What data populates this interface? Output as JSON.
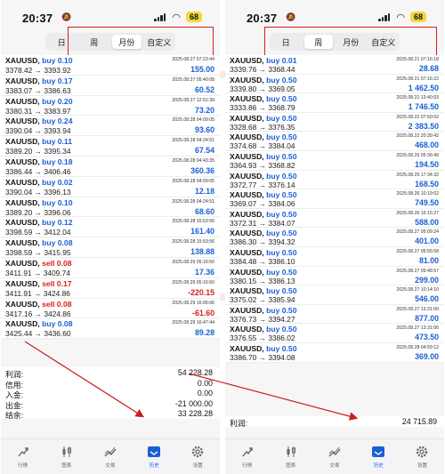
{
  "left": {
    "status": {
      "time": "20:37",
      "battery": "68"
    },
    "periods": [
      {
        "label": "日",
        "active": false
      },
      {
        "label": "周",
        "active": false
      },
      {
        "label": "月份",
        "active": true
      },
      {
        "label": "自定义",
        "active": false
      }
    ],
    "trades": [
      {
        "symbol": "XAUUSD,",
        "side": "buy 0.10",
        "side_type": "buy",
        "time": "2025.08.27 07:23:44",
        "open": "3378.42",
        "close": "3393.92",
        "profit": "155.00",
        "neg": false
      },
      {
        "symbol": "XAUUSD,",
        "side": "buy 0.17",
        "side_type": "buy",
        "time": "2025.08.27 05:40:08",
        "open": "3383.07",
        "close": "3386.63",
        "profit": "60.52",
        "neg": false
      },
      {
        "symbol": "XAUUSD,",
        "side": "buy 0.20",
        "time": "2025.08.27 12:51:39",
        "side_type": "buy",
        "open": "3380.31",
        "close": "3383.97",
        "profit": "73.20",
        "neg": false
      },
      {
        "symbol": "XAUUSD,",
        "side": "buy 0.24",
        "side_type": "buy",
        "time": "2025.08.28 04:09:05",
        "open": "3390.04",
        "close": "3393.94",
        "profit": "93.60",
        "neg": false
      },
      {
        "symbol": "XAUUSD,",
        "side": "buy 0.11",
        "side_type": "buy",
        "time": "2025.08.28 04:24:51",
        "open": "3389.20",
        "close": "3395.34",
        "profit": "67.54",
        "neg": false
      },
      {
        "symbol": "XAUUSD,",
        "side": "buy 0.18",
        "side_type": "buy",
        "time": "2025.08.28 04:43:35",
        "open": "3386.44",
        "close": "3406.46",
        "profit": "360.36",
        "neg": false
      },
      {
        "symbol": "XAUUSD,",
        "side": "buy 0.02",
        "side_type": "buy",
        "time": "2025.08.28 04:09:05",
        "open": "3390.04",
        "close": "3396.13",
        "profit": "12.18",
        "neg": false
      },
      {
        "symbol": "XAUUSD,",
        "side": "buy 0.10",
        "side_type": "buy",
        "time": "2025.08.28 04:24:51",
        "open": "3389.20",
        "close": "3396.06",
        "profit": "68.60",
        "neg": false
      },
      {
        "symbol": "XAUUSD,",
        "side": "buy 0.12",
        "side_type": "buy",
        "time": "2025.08.28 15:53:56",
        "open": "3398.59",
        "close": "3412.04",
        "profit": "161.40",
        "neg": false
      },
      {
        "symbol": "XAUUSD,",
        "side": "buy 0.08",
        "side_type": "buy",
        "time": "2025.08.28 15:53:56",
        "open": "3398.59",
        "close": "3415.95",
        "profit": "138.88",
        "neg": false
      },
      {
        "symbol": "XAUUSD,",
        "side": "sell 0.08",
        "side_type": "sell",
        "time": "2025.08.29 05:16:50",
        "open": "3411.91",
        "close": "3409.74",
        "profit": "17.36",
        "neg": false
      },
      {
        "symbol": "XAUUSD,",
        "side": "sell 0.17",
        "side_type": "sell",
        "time": "2025.08.29 05:16:50",
        "open": "3411.91",
        "close": "3424.86",
        "profit": "-220.15",
        "neg": true
      },
      {
        "symbol": "XAUUSD,",
        "side": "sell 0.08",
        "side_type": "sell",
        "time": "2025.08.29 16:05:06",
        "open": "3417.16",
        "close": "3424.86",
        "profit": "-61.60",
        "neg": true
      },
      {
        "symbol": "XAUUSD,",
        "side": "buy 0.08",
        "side_type": "buy",
        "time": "2025.08.29 16:47:44",
        "open": "3425.44",
        "close": "3436.60",
        "profit": "89.28",
        "neg": false
      }
    ],
    "summary": [
      {
        "label": "利润:",
        "value": "54 228.28"
      },
      {
        "label": "信用:",
        "value": "0.00"
      },
      {
        "label": "入金:",
        "value": "0.00"
      },
      {
        "label": "出金:",
        "value": "-21 000.00"
      },
      {
        "label": "结余:",
        "value": "33 228.28"
      }
    ]
  },
  "right": {
    "status": {
      "time": "20:37",
      "battery": "68"
    },
    "periods": [
      {
        "label": "日",
        "active": false
      },
      {
        "label": "周",
        "active": true
      },
      {
        "label": "月份",
        "active": false
      },
      {
        "label": "自定义",
        "active": false
      }
    ],
    "trades": [
      {
        "symbol": "XAUUSD,",
        "side": "buy 0.01",
        "side_type": "buy",
        "time": "2025.08.21 07:16:18",
        "open": "3339.76",
        "close": "3368.44",
        "profit": "28.68",
        "neg": false
      },
      {
        "symbol": "XAUUSD,",
        "side": "buy 0.50",
        "side_type": "buy",
        "time": "2025.08.21 07:16:22",
        "open": "3339.80",
        "close": "3369.05",
        "profit": "1 462.50",
        "neg": false
      },
      {
        "symbol": "XAUUSD,",
        "side": "buy 0.50",
        "side_type": "buy",
        "time": "2025.08.21 13:40:03",
        "open": "3333.86",
        "close": "3368.79",
        "profit": "1 746.50",
        "neg": false
      },
      {
        "symbol": "XAUUSD,",
        "side": "buy 0.50",
        "side_type": "buy",
        "time": "2025.08.22 07:50:02",
        "open": "3328.68",
        "close": "3376.35",
        "profit": "2 383.50",
        "neg": false
      },
      {
        "symbol": "XAUUSD,",
        "side": "buy 0.50",
        "side_type": "buy",
        "time": "2025.08.22 20:39:42",
        "open": "3374.68",
        "close": "3384.04",
        "profit": "468.00",
        "neg": false
      },
      {
        "symbol": "XAUUSD,",
        "side": "buy 0.50",
        "side_type": "buy",
        "time": "2025.08.25 05:36:49",
        "open": "3364.93",
        "close": "3368.82",
        "profit": "194.50",
        "neg": false
      },
      {
        "symbol": "XAUUSD,",
        "side": "buy 0.50",
        "side_type": "buy",
        "time": "2025.08.25 17:34:32",
        "open": "3372.77",
        "close": "3376.14",
        "profit": "168.50",
        "neg": false
      },
      {
        "symbol": "XAUUSD,",
        "side": "buy 0.50",
        "side_type": "buy",
        "time": "2025.08.26 10:19:02",
        "open": "3369.07",
        "close": "3384.06",
        "profit": "749.50",
        "neg": false
      },
      {
        "symbol": "XAUUSD,",
        "side": "buy 0.50",
        "side_type": "buy",
        "time": "2025.08.26 16:15:27",
        "open": "3372.31",
        "close": "3384.07",
        "profit": "588.00",
        "neg": false
      },
      {
        "symbol": "XAUUSD,",
        "side": "buy 0.50",
        "side_type": "buy",
        "time": "2025.08.27 05:09:24",
        "open": "3386.30",
        "close": "3394.32",
        "profit": "401.00",
        "neg": false
      },
      {
        "symbol": "XAUUSD,",
        "side": "buy 0.50",
        "side_type": "buy",
        "time": "2025.08.27 05:55:58",
        "open": "3384.48",
        "close": "3386.10",
        "profit": "81.00",
        "neg": false
      },
      {
        "symbol": "XAUUSD,",
        "side": "buy 0.50",
        "side_type": "buy",
        "time": "2025.08.27 09:48:57",
        "open": "3380.15",
        "close": "3386.13",
        "profit": "299.00",
        "neg": false
      },
      {
        "symbol": "XAUUSD,",
        "side": "buy 0.50",
        "side_type": "buy",
        "time": "2025.08.27 10:14:10",
        "open": "3375.02",
        "close": "3385.94",
        "profit": "546.00",
        "neg": false
      },
      {
        "symbol": "XAUUSD,",
        "side": "buy 0.50",
        "side_type": "buy",
        "time": "2025.08.27 13:31:00",
        "open": "3376.73",
        "close": "3394.27",
        "profit": "877.00",
        "neg": false
      },
      {
        "symbol": "XAUUSD,",
        "side": "buy 0.50",
        "side_type": "buy",
        "time": "2025.08.27 13:31:06",
        "open": "3376.55",
        "close": "3386.02",
        "profit": "473.50",
        "neg": false
      },
      {
        "symbol": "XAUUSD,",
        "side": "buy 0.50",
        "side_type": "buy",
        "time": "2025.08.28 04:59:12",
        "open": "3386.70",
        "close": "3394.08",
        "profit": "369.00",
        "neg": false
      }
    ],
    "summary": [
      {
        "label": "利润:",
        "value": "24 715.89"
      }
    ]
  },
  "tabs": [
    {
      "label": "行情",
      "icon": "quotes-icon",
      "active": false
    },
    {
      "label": "图表",
      "icon": "candles-icon",
      "active": false
    },
    {
      "label": "交易",
      "icon": "trade-icon",
      "active": false
    },
    {
      "label": "历史",
      "icon": "history-icon",
      "active": true
    },
    {
      "label": "设置",
      "icon": "gear-icon",
      "active": false
    }
  ],
  "colors": {
    "buy": "#1a5fd6",
    "sell": "#d81e1e",
    "highlight": "#d81e1e",
    "battery": "#f3d83a"
  }
}
